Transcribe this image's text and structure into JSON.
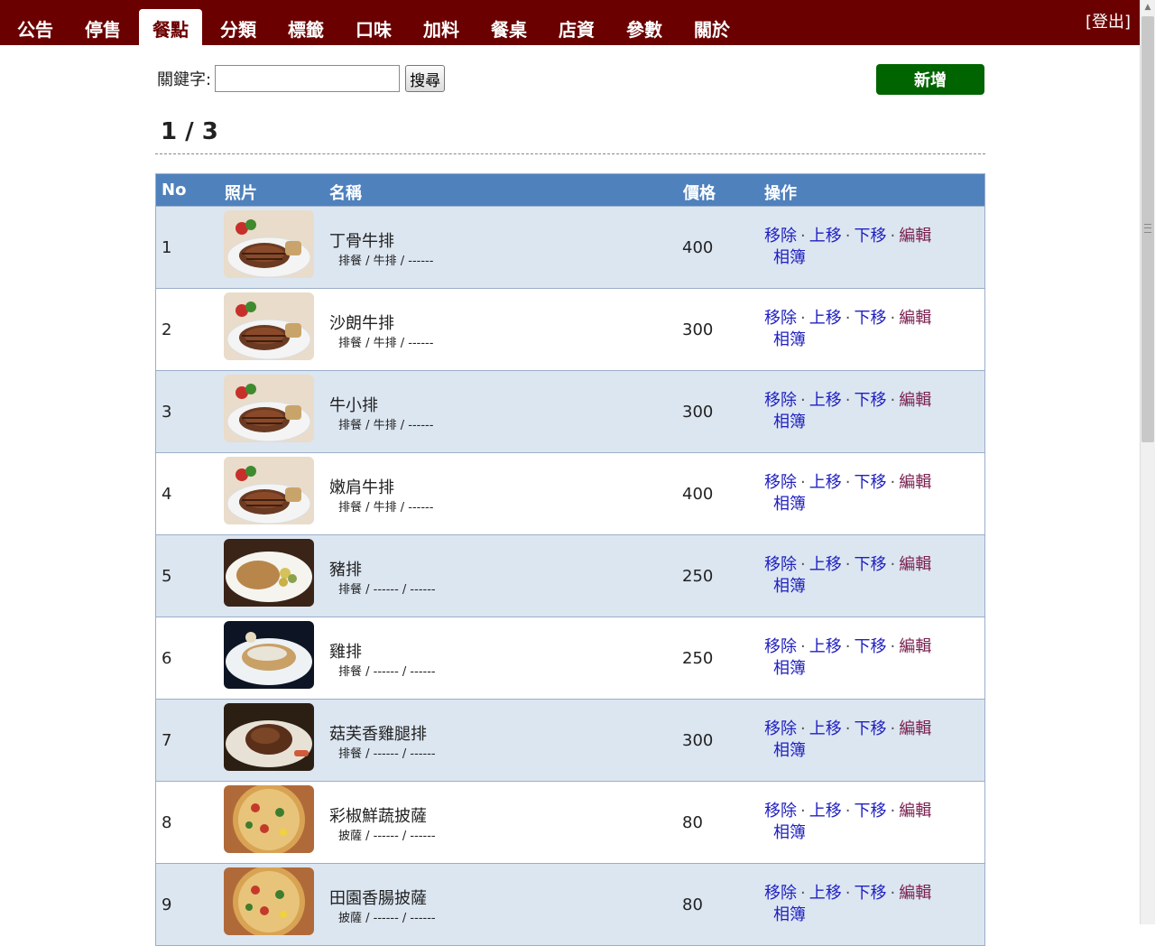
{
  "nav": {
    "tabs": [
      {
        "label": "公告",
        "active": false
      },
      {
        "label": "停售",
        "active": false
      },
      {
        "label": "餐點",
        "active": true
      },
      {
        "label": "分類",
        "active": false
      },
      {
        "label": "標籤",
        "active": false
      },
      {
        "label": "口味",
        "active": false
      },
      {
        "label": "加料",
        "active": false
      },
      {
        "label": "餐桌",
        "active": false
      },
      {
        "label": "店資",
        "active": false
      },
      {
        "label": "參數",
        "active": false
      },
      {
        "label": "關於",
        "active": false
      }
    ],
    "logout": "[登出]"
  },
  "search": {
    "label": "關鍵字:",
    "value": "",
    "button": "搜尋"
  },
  "add_button": "新增",
  "pagination": "1 / 3",
  "table": {
    "headers": {
      "no": "No",
      "photo": "照片",
      "name": "名稱",
      "price": "價格",
      "ops": "操作"
    },
    "actions": {
      "remove": "移除",
      "up": "上移",
      "down": "下移",
      "edit": "編輯",
      "album": "相簿"
    },
    "rows": [
      {
        "no": "1",
        "name": "丁骨牛排",
        "tags": "排餐 / 牛排 / ------",
        "price": "400",
        "photo": "steak-photo"
      },
      {
        "no": "2",
        "name": "沙朗牛排",
        "tags": "排餐 / 牛排 / ------",
        "price": "300",
        "photo": "steak-photo"
      },
      {
        "no": "3",
        "name": "牛小排",
        "tags": "排餐 / 牛排 / ------",
        "price": "300",
        "photo": "steak-photo"
      },
      {
        "no": "4",
        "name": "嫩肩牛排",
        "tags": "排餐 / 牛排 / ------",
        "price": "400",
        "photo": "steak-photo"
      },
      {
        "no": "5",
        "name": "豬排",
        "tags": "排餐 / ------ / ------",
        "price": "250",
        "photo": "pork-chop-photo"
      },
      {
        "no": "6",
        "name": "雞排",
        "tags": "排餐 / ------ / ------",
        "price": "250",
        "photo": "chicken-photo"
      },
      {
        "no": "7",
        "name": "菇芙香雞腿排",
        "tags": "排餐 / ------ / ------",
        "price": "300",
        "photo": "chicken-leg-photo"
      },
      {
        "no": "8",
        "name": "彩椒鮮蔬披薩",
        "tags": "披薩 / ------ / ------",
        "price": "80",
        "photo": "pizza-photo"
      },
      {
        "no": "9",
        "name": "田園香腸披薩",
        "tags": "披薩 / ------ / ------",
        "price": "80",
        "photo": "pizza-photo"
      }
    ]
  },
  "colors": {
    "topbar": "#6b0000",
    "header": "#4f81bd",
    "row_alt": "#dce6f1",
    "add_button": "#006400",
    "link": "#2020c0"
  }
}
